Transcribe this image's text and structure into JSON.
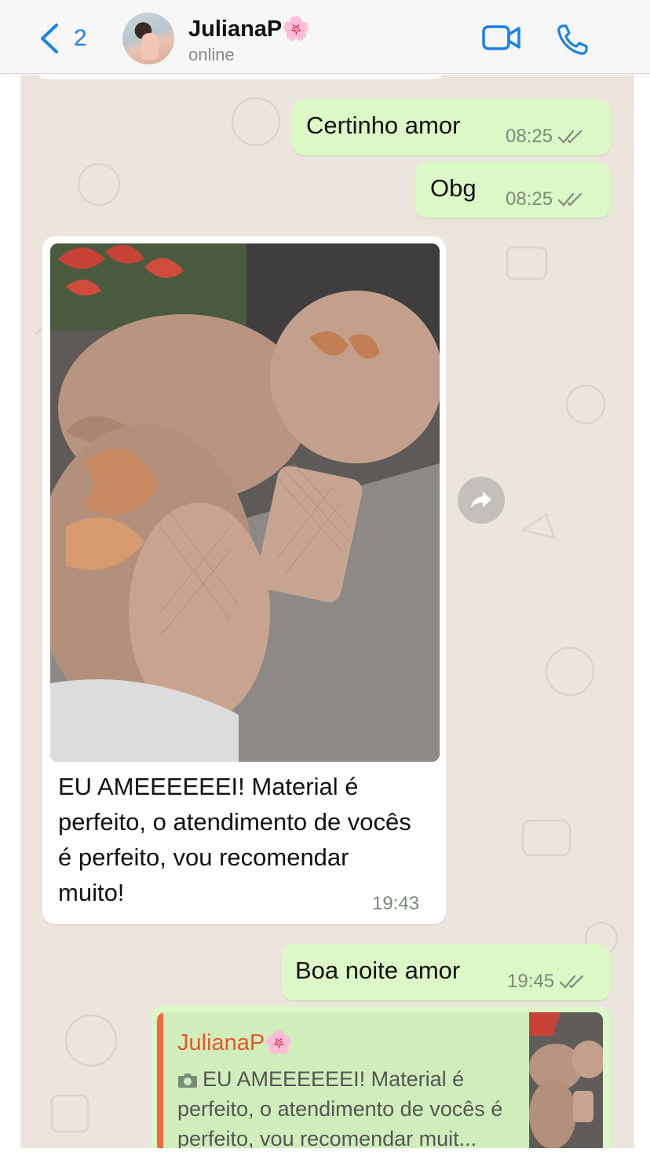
{
  "header": {
    "back_count": "2",
    "contact_name": "JulianaP🌸",
    "status": "online",
    "icons": [
      "chevron-left-icon",
      "video-camera-icon",
      "phone-icon"
    ],
    "accent_color": "#1a82e8"
  },
  "messages": [
    {
      "direction": "outgoing",
      "text": "Certinho amor",
      "time": "08:25",
      "ticks": "double-check"
    },
    {
      "direction": "outgoing",
      "text": "Obg",
      "time": "08:25",
      "ticks": "double-check"
    },
    {
      "direction": "incoming",
      "type": "image",
      "caption": "EU AMEEEEEEI! Material é perfeito, o atendimento de vocês é perfeito, vou recomendar muito!",
      "time": "19:43"
    },
    {
      "direction": "outgoing",
      "text": "Boa noite amor",
      "time": "19:45",
      "ticks": "double-check"
    }
  ],
  "reply_preview": {
    "name": "JulianaP🌸",
    "text": "EU AMEEEEEEI! Material é perfeito, o atendimento de vocês é perfeito, vou recomendar muit..."
  },
  "colors": {
    "outgoing_bubble": "#dcf8c6",
    "incoming_bubble": "#ffffff",
    "chat_background": "#ece5dd",
    "quote_name": "#e8552d"
  }
}
